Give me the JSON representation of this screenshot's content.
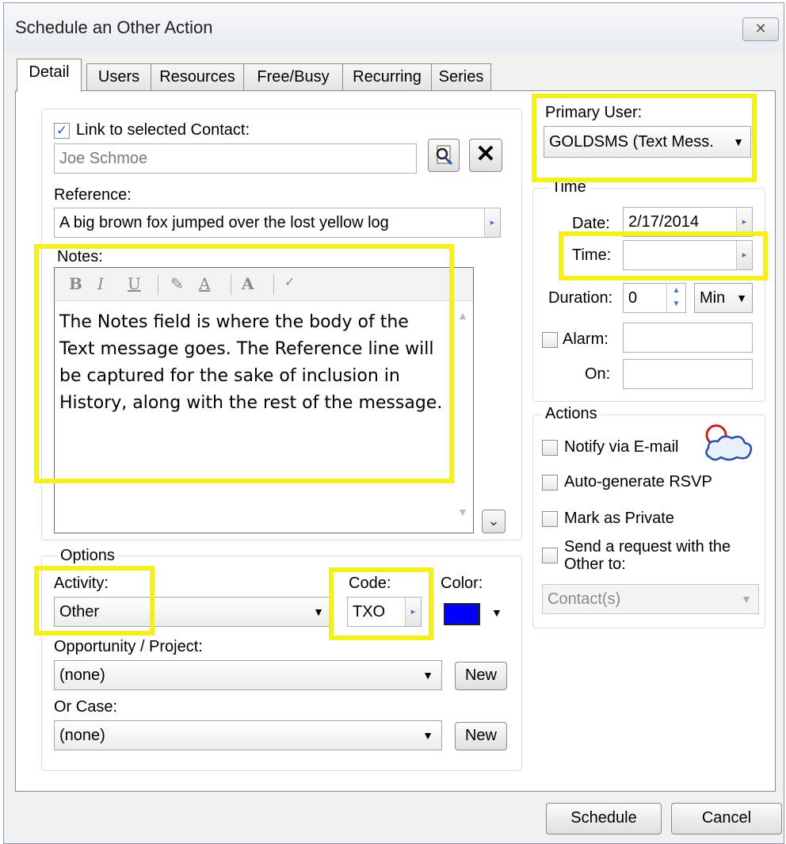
{
  "window": {
    "title": "Schedule an Other Action",
    "close_label": "✕"
  },
  "tabs": [
    "Detail",
    "Users",
    "Resources",
    "Free/Busy",
    "Recurring",
    "Series"
  ],
  "contact": {
    "link_label": "Link to selected Contact:",
    "link_checked": true,
    "value": "Joe Schmoe",
    "lookup_icon": "contact-lookup-icon",
    "clear_icon": "clear-x-icon"
  },
  "reference": {
    "label": "Reference:",
    "value": "A big brown fox jumped over the lost yellow log"
  },
  "notes": {
    "label": "Notes:",
    "toolbar": [
      "B",
      "I",
      "U",
      "highlighter",
      "font-color",
      "font-size",
      "spellcheck"
    ],
    "body": "The Notes field is where the body of the Text message goes. The Reference line will be captured for the sake of inclusion in History, along with the rest of the message."
  },
  "primary_user": {
    "label": "Primary User:",
    "value": "GOLDSMS (Text Mess."
  },
  "time_group": {
    "label": "Time",
    "date_label": "Date:",
    "date_value": "2/17/2014",
    "time_label": "Time:",
    "time_value": "",
    "duration_label": "Duration:",
    "duration_value": "0",
    "duration_unit": "Min",
    "alarm_label": "Alarm:",
    "on_label": "On:"
  },
  "actions": {
    "label": "Actions",
    "notify": "Notify via E-mail",
    "rsvp": "Auto-generate RSVP",
    "private": "Mark as Private",
    "send_request_1": "Send a request with the",
    "send_request_2": "Other to:",
    "contacts_value": "Contact(s)"
  },
  "options": {
    "label": "Options",
    "activity_label": "Activity:",
    "activity_value": "Other",
    "code_label": "Code:",
    "code_value": "TXO",
    "color_label": "Color:",
    "color_value": "#0000ff",
    "opportunity_label": "Opportunity / Project:",
    "opportunity_value": "(none)",
    "case_label": "Or Case:",
    "case_value": "(none)",
    "new_label": "New"
  },
  "buttons": {
    "schedule": "Schedule",
    "cancel": "Cancel"
  },
  "colors": {
    "highlight": "#f3f01c",
    "swatch": "#0000ff"
  }
}
